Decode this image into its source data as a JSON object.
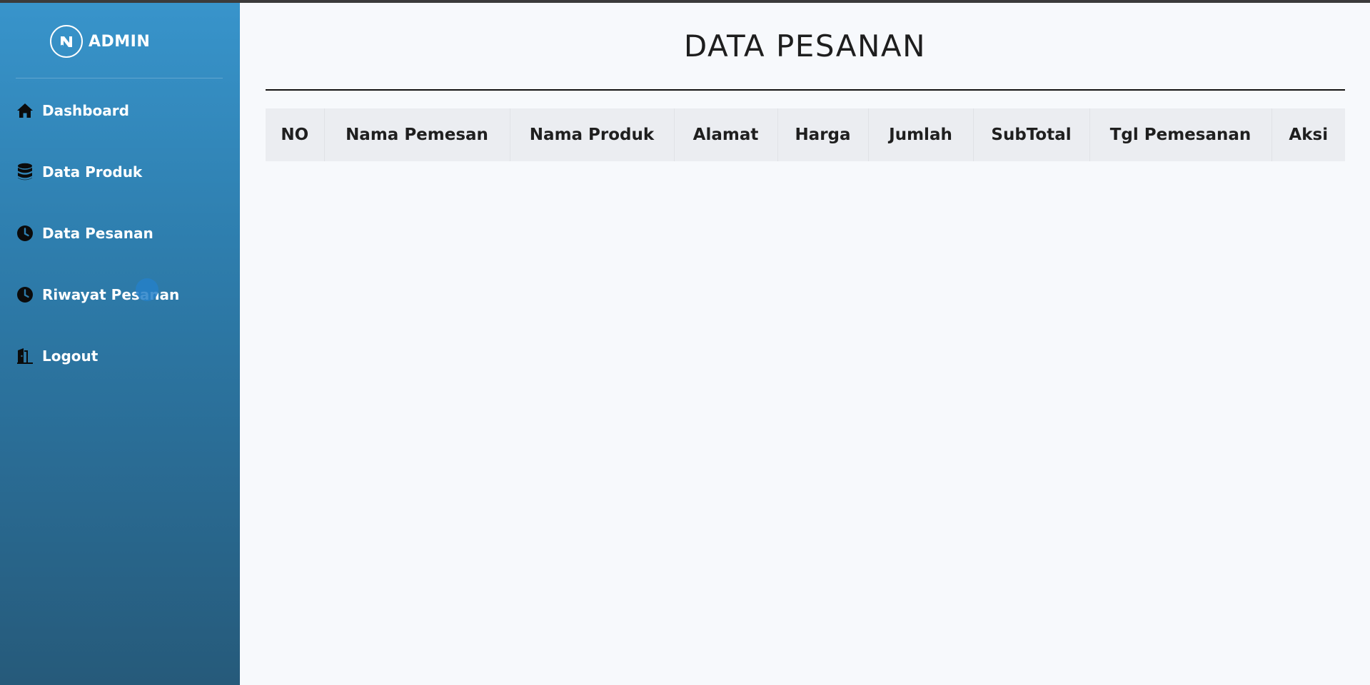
{
  "brand": {
    "name": "ADMIN"
  },
  "sidebar": {
    "items": [
      {
        "label": "Dashboard",
        "icon": "home-icon"
      },
      {
        "label": "Data Produk",
        "icon": "database-icon"
      },
      {
        "label": "Data Pesanan",
        "icon": "clock-icon"
      },
      {
        "label": "Riwayat Pesanan",
        "icon": "clock-icon"
      },
      {
        "label": "Logout",
        "icon": "door-exit-icon"
      }
    ]
  },
  "main": {
    "title": "DATA PESANAN",
    "table": {
      "columns": [
        "NO",
        "Nama Pemesan",
        "Nama Produk",
        "Alamat",
        "Harga",
        "Jumlah",
        "SubTotal",
        "Tgl Pemesanan",
        "Aksi"
      ],
      "rows": []
    }
  },
  "colors": {
    "sidebar_top": "#3894cb",
    "sidebar_bottom": "#265a7a",
    "page_background": "#f7f9fc",
    "table_header": "#ebedf1"
  }
}
